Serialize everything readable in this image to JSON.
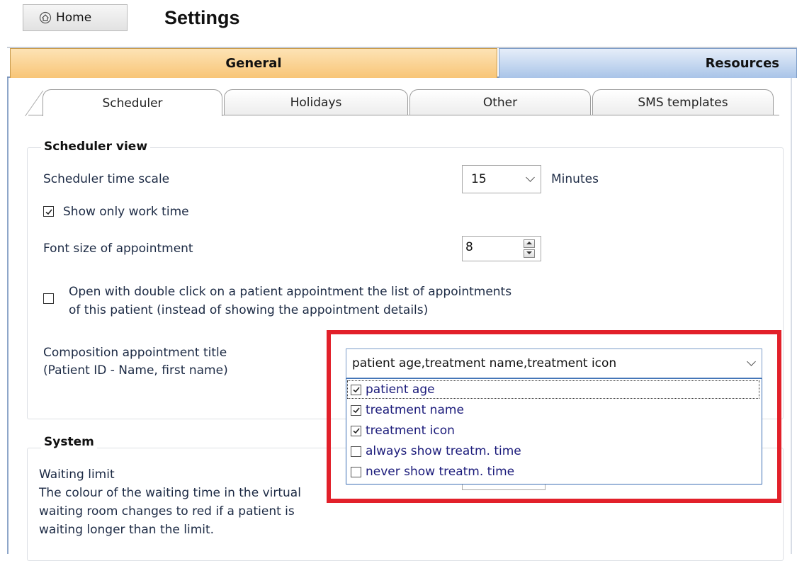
{
  "header": {
    "home_label": "Home",
    "title": "Settings"
  },
  "main_tabs": [
    {
      "label": "General",
      "active": true
    },
    {
      "label": "Resources",
      "active": false
    }
  ],
  "sub_tabs": [
    {
      "label": "Scheduler",
      "active": true
    },
    {
      "label": "Holidays",
      "active": false
    },
    {
      "label": "Other",
      "active": false
    },
    {
      "label": "SMS templates",
      "active": false
    }
  ],
  "scheduler_view": {
    "title": "Scheduler view",
    "time_scale_label": "Scheduler time scale",
    "time_scale_value": "15",
    "time_scale_unit": "Minutes",
    "show_work_time_label": "Show only work time",
    "show_work_time_checked": true,
    "font_size_label": "Font size of appointment",
    "font_size_value": "8",
    "double_click_label_line1": "Open with double click on a patient appointment the list of appointments",
    "double_click_label_line2": "of this patient (instead of showing the appointment details)",
    "double_click_checked": false,
    "composition_label_line1": "Composition appointment title",
    "composition_label_line2": "(Patient ID - Name, first name)",
    "composition_value": "patient age,treatment name,treatment icon",
    "composition_options": [
      {
        "label": "patient age",
        "checked": true
      },
      {
        "label": "treatment name",
        "checked": true
      },
      {
        "label": "treatment icon",
        "checked": true
      },
      {
        "label": "always show treatm. time",
        "checked": false
      },
      {
        "label": "never show treatm. time",
        "checked": false
      }
    ]
  },
  "system": {
    "title": "System",
    "waiting_limit_label": "Waiting limit",
    "waiting_desc_line1": "The colour of the waiting time in the virtual",
    "waiting_desc_line2": "waiting room changes to red if a patient is",
    "waiting_desc_line3": "waiting longer than the limit."
  },
  "colors": {
    "general_tab": "#f8c577",
    "resources_tab": "#a9c4e8",
    "highlight": "#e2202a"
  }
}
